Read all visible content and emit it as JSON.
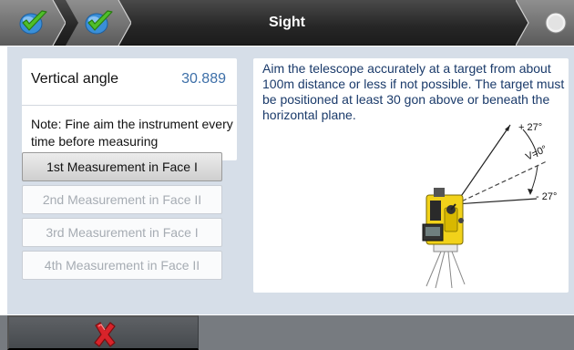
{
  "header": {
    "title": "Sight",
    "steps": [
      {
        "icon": "checkmark-icon",
        "state": "done"
      },
      {
        "icon": "checkmark-icon",
        "state": "done"
      }
    ],
    "status_icon": "status-circle-icon"
  },
  "measurement": {
    "label": "Vertical angle",
    "value": "30.889",
    "note": "Note: Fine aim the instrument every time before measuring"
  },
  "buttons": [
    {
      "label": "1st Measurement in Face I",
      "enabled": true
    },
    {
      "label": "2nd Measurement in Face II",
      "enabled": false
    },
    {
      "label": "3rd Measurement in Face I",
      "enabled": false
    },
    {
      "label": "4th Measurement in Face II",
      "enabled": false
    }
  ],
  "instruction": {
    "text": "Aim the telescope accurately at a target from about 100m distance or less if not possible. The target must be positioned at least 30 gon above or beneath the horizontal plane.",
    "diagram": {
      "upper_label": "+ 27°",
      "horizontal_label": "V=0°",
      "lower_label": "- 27°"
    }
  },
  "footer": {
    "cancel_icon": "cancel-x-icon"
  },
  "colors": {
    "header_bg": "#262626",
    "panel_bg": "#d6dee8",
    "value_color": "#3d6fa8",
    "check_green": "#4fbf2a",
    "check_blue": "#3a8fd8",
    "cancel_red": "#d8232a",
    "instrument_yellow": "#f2d21a"
  }
}
